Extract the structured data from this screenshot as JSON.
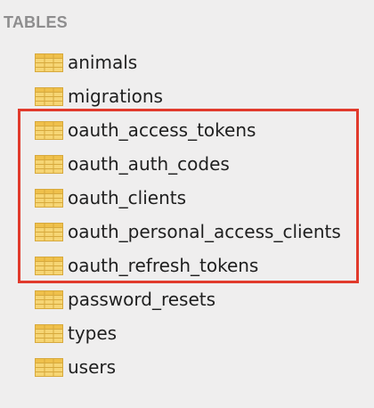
{
  "sidebar": {
    "section_title": "TABLES",
    "items": [
      {
        "label": "animals"
      },
      {
        "label": "migrations"
      },
      {
        "label": "oauth_access_tokens"
      },
      {
        "label": "oauth_auth_codes"
      },
      {
        "label": "oauth_clients"
      },
      {
        "label": "oauth_personal_access_clients"
      },
      {
        "label": "oauth_refresh_tokens"
      },
      {
        "label": "password_resets"
      },
      {
        "label": "types"
      },
      {
        "label": "users"
      }
    ],
    "item_icon": "table-icon",
    "highlight_color": "#e13a2c",
    "icon_color": "#f4cd63"
  }
}
